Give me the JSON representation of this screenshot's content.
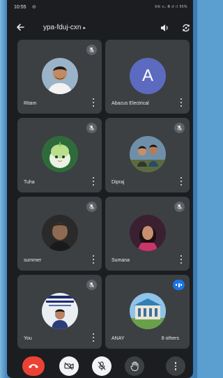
{
  "status_bar": {
    "time": "10:55",
    "extra": "⊖",
    "right_indicators": "ℵℵ ⅴ₀ Ⅲ ⅆ ıl 95%"
  },
  "header": {
    "meeting_code": "ypa-fduj-cxn",
    "chevron": "▸"
  },
  "participants": [
    {
      "name": "Ritam",
      "muted": true,
      "avatar": "photo"
    },
    {
      "name": "Abacus Electrical",
      "muted": false,
      "avatar": "letter",
      "letter": "A",
      "avatar_color": "#5c6bc0"
    },
    {
      "name": "Tuha",
      "muted": true,
      "avatar": "photo"
    },
    {
      "name": "Dipraj",
      "muted": true,
      "avatar": "photo"
    },
    {
      "name": "summer",
      "muted": true,
      "avatar": "photo"
    },
    {
      "name": "Sumana",
      "muted": true,
      "avatar": "photo"
    },
    {
      "name": "You",
      "muted": true,
      "avatar": "photo"
    },
    {
      "name": "ANAY",
      "muted": false,
      "speaking": true,
      "avatar": "photo"
    }
  ],
  "others_label": "8 others",
  "controls": {
    "end_call_color": "#ea4335",
    "items": [
      "end-call",
      "camera-off",
      "mic-off",
      "raise-hand",
      "more-options"
    ]
  },
  "colors": {
    "background": "#1c1d21",
    "tile": "#3c4043",
    "accent": "#1a73e8"
  }
}
